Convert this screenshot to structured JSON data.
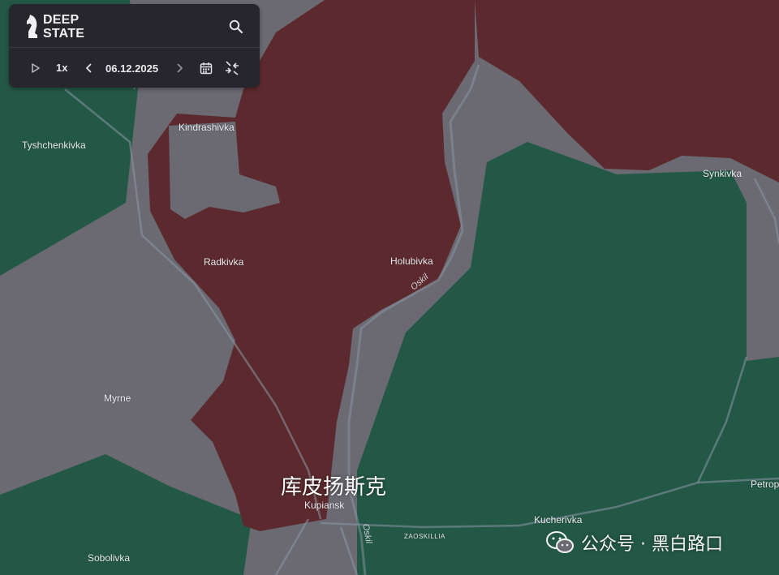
{
  "app": {
    "logo_line1": "DEEP",
    "logo_line2": "STATE",
    "speed": "1x",
    "date": "06.12.2025"
  },
  "icons": [
    "knight-logo-icon",
    "search-icon",
    "play-icon",
    "chevron-left-icon",
    "chevron-right-icon",
    "calendar-icon",
    "collapse-icon",
    "wechat-icon"
  ],
  "colors": {
    "occupied": "#5c2a2e",
    "contested": "#6b6a72",
    "ukraine": "#245846",
    "roads": "#8a97a8"
  },
  "places": {
    "kindrashivka": "Kindrashivka",
    "tyshchenkivka": "Tyshchenkivka",
    "synkivka": "Synkivka",
    "radkivka": "Radkivka",
    "holubivka": "Holubivka",
    "myrne": "Myrne",
    "kupiansk": "Kupiansk",
    "kucherivka": "Kucherivka",
    "petrop": "Petrop",
    "sobolivka": "Sobolivka",
    "zaoskillia": "ZAOSKILLIA"
  },
  "rivers": {
    "oskil_north": "Oskil",
    "oskil_south": "Oskil"
  },
  "overlay_label": "库皮扬斯克",
  "watermark": {
    "text": "公众号 · 黑白路口"
  }
}
